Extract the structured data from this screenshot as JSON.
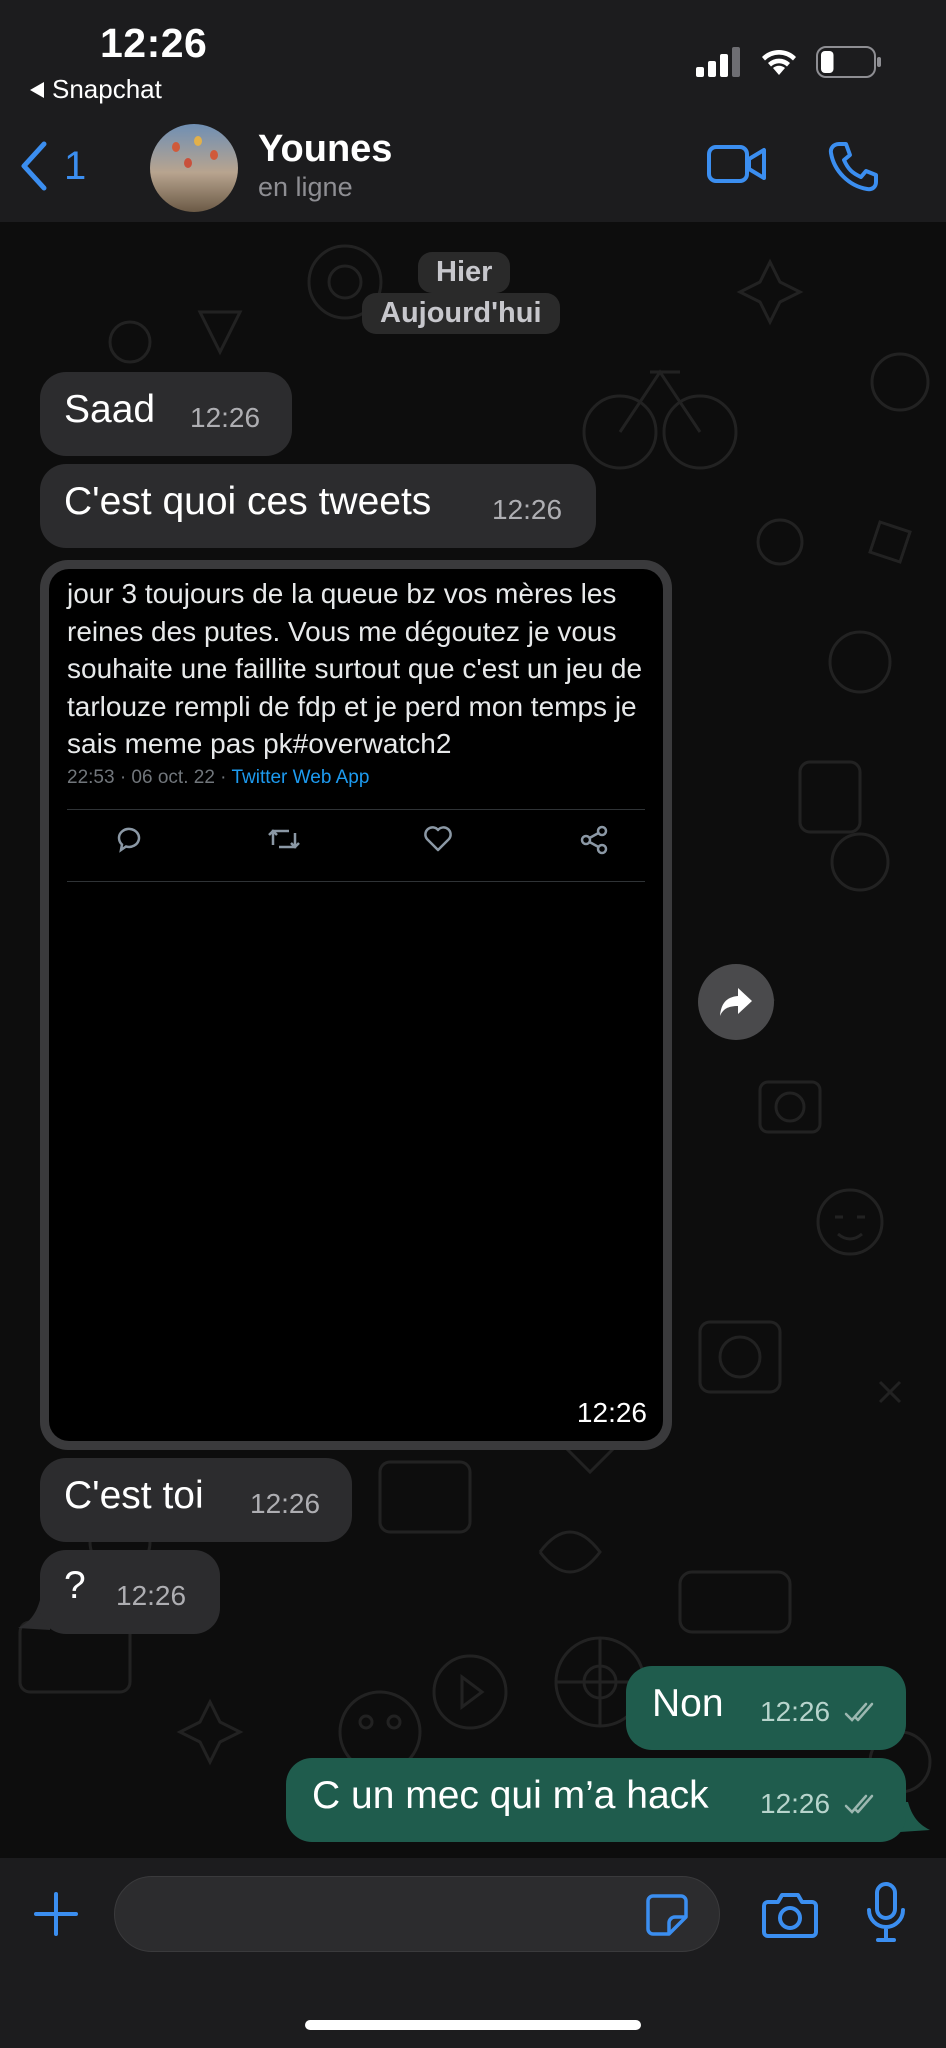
{
  "status_bar": {
    "time": "12:26",
    "back_app": "Snapchat",
    "battery_level": 0.25
  },
  "header": {
    "back_count": "1",
    "name": "Younes",
    "status": "en ligne"
  },
  "date_pills": [
    "Hier",
    "Aujourd'hui"
  ],
  "messages": [
    {
      "text": "Saad",
      "time": "12:26"
    },
    {
      "text": "C'est quoi ces tweets",
      "time": "12:26"
    },
    {
      "text": "C'est toi",
      "time": "12:26"
    },
    {
      "text": "?",
      "time": "12:26"
    }
  ],
  "tweet": {
    "text": "jour 3 toujours de la queue bz vos mères les reines des putes. Vous me dégoutez je vous souhaite une faillite surtout que c'est un jeu de tarlouze rempli de fdp et je perd mon temps je sais meme pas pk#overwatch2",
    "meta": "22:53 · 06 oct. 22 · ",
    "source": "Twitter Web App",
    "time": "12:26"
  },
  "outgoing": [
    {
      "text": "Non",
      "time": "12:26"
    },
    {
      "text": "C un mec qui m’a hack",
      "time": "12:26"
    }
  ],
  "colors": {
    "accent": "#3b8ef0",
    "outgoing_bubble": "#1f5c4d",
    "incoming_bubble": "#2c2c2e"
  }
}
